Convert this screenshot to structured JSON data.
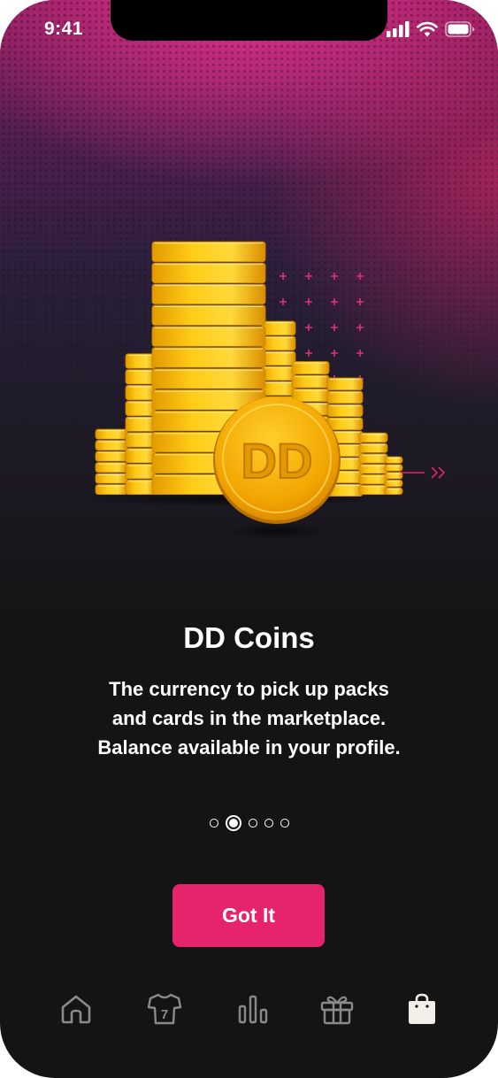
{
  "status_bar": {
    "time": "9:41",
    "icons": [
      "cellular-signal-icon",
      "wifi-icon",
      "battery-icon"
    ]
  },
  "illustration": {
    "coin_label": "DD",
    "icon": "coin-stacks-illustration"
  },
  "onboarding": {
    "title": "DD Coins",
    "description_lines": [
      "The currency to pick up packs",
      "and cards in the marketplace.",
      "Balance available in your profile."
    ],
    "page_count": 5,
    "active_page": 2
  },
  "cta": {
    "label": "Got It"
  },
  "tab_bar": {
    "items": [
      {
        "icon": "home-icon",
        "active": false
      },
      {
        "icon": "jersey-icon",
        "jersey_number": "7",
        "active": false
      },
      {
        "icon": "stats-icon",
        "active": false
      },
      {
        "icon": "gift-icon",
        "active": false
      },
      {
        "icon": "shopping-bag-icon",
        "active": true
      }
    ]
  },
  "colors": {
    "accent": "#e6236d",
    "background": "#141414",
    "coin_gold": "#f5b800",
    "tab_inactive": "#8a8a8a",
    "tab_active": "#f2efe8"
  }
}
